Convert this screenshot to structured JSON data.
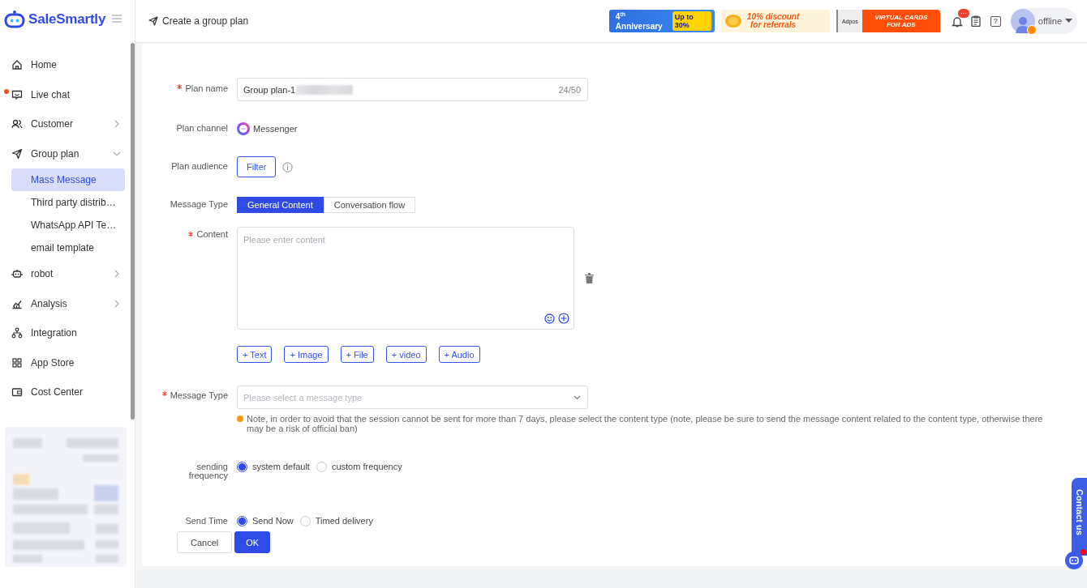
{
  "logo": {
    "name": "SaleSmartly"
  },
  "header": {
    "title": "Create a group plan",
    "banners": [
      {
        "kind": "anniversary",
        "texts": [
          "4$^{th}$ Anniversary",
          "Up to 30%"
        ]
      },
      {
        "kind": "discount",
        "texts": [
          "10% discount",
          "for referrals"
        ]
      },
      {
        "kind": "cards",
        "texts": [
          "Adpos",
          "VIRTUAL CARDS FOR ADS"
        ]
      }
    ],
    "notification_badge": "···",
    "help": "?",
    "status": "offline"
  },
  "sidebar": {
    "items": [
      {
        "label": "Home"
      },
      {
        "label": "Live chat",
        "unread": true
      },
      {
        "label": "Customer",
        "expanded": false
      },
      {
        "label": "Group plan",
        "expanded": true,
        "children": [
          {
            "label": "Mass Message",
            "selected": true
          },
          {
            "label": "Third party distrib…",
            "selected": false
          },
          {
            "label": "WhatsApp API Te…",
            "selected": false
          },
          {
            "label": "email template",
            "selected": false
          }
        ]
      },
      {
        "label": "robot",
        "expanded": false
      },
      {
        "label": "Analysis",
        "expanded": false
      },
      {
        "label": "Integration"
      },
      {
        "label": "App Store"
      },
      {
        "label": "Cost Center"
      }
    ]
  },
  "form": {
    "rows": [
      {
        "kind": "text",
        "label": "Plan name",
        "required": true,
        "value": "Group plan-1",
        "redacted": true,
        "counter": "24/50"
      },
      {
        "kind": "channel",
        "label": "Plan channel",
        "value": "Messenger"
      },
      {
        "kind": "filter",
        "label": "Plan audience",
        "button": "Filter"
      },
      {
        "kind": "segmented",
        "label": "Message Type",
        "options": [
          {
            "label": "General Content",
            "selected": true
          },
          {
            "label": "Conversation flow",
            "selected": false
          }
        ]
      },
      {
        "kind": "editor",
        "label": "Content",
        "required": true,
        "placeholder": "Please enter content",
        "add_buttons": [
          "+ Text",
          "+ Image",
          "+ File",
          "+ video",
          "+ Audio"
        ]
      },
      {
        "kind": "select",
        "label": "Message Type",
        "required": true,
        "placeholder": "Please select a message type",
        "note": "Note, in order to avoid that the session cannot be sent for more than 7 days, please select the content type (note, please be sure to send the message content related to the content type, otherwise there may be a risk of official ban)"
      },
      {
        "kind": "radio",
        "label": "sending frequency",
        "options": [
          {
            "label": "system default",
            "selected": true
          },
          {
            "label": "custom frequency",
            "selected": false
          }
        ]
      },
      {
        "kind": "radio",
        "label": "Send Time",
        "options": [
          {
            "label": "Send Now",
            "selected": true
          },
          {
            "label": "Timed delivery",
            "selected": false
          }
        ]
      }
    ],
    "buttons": [
      {
        "label": "Cancel",
        "kind": "default"
      },
      {
        "label": "OK",
        "kind": "primary"
      }
    ]
  },
  "contact_tab": {
    "label": "Contact us"
  }
}
